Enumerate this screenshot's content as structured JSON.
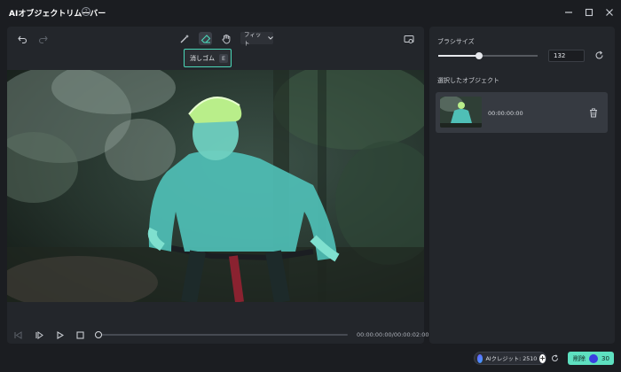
{
  "window": {
    "title": "AIオブジェクトリムーバー",
    "help_symbol": "?"
  },
  "toolbar": {
    "fit_label": "フィット",
    "tooltip_label": "消しゴム",
    "tooltip_key": "E"
  },
  "playback": {
    "time": "00:00:00:00/00:00:02:00"
  },
  "right_panel": {
    "brush_size_label": "ブラシサイズ",
    "brush_size_value": "132",
    "brush_size_fraction": 0.41,
    "selected_objects_label": "選択したオブジェクト",
    "objects": [
      {
        "time": "00:00:00:00"
      }
    ]
  },
  "footer": {
    "credit_text": "AIクレジット: 2510",
    "remove_label": "削除",
    "remove_cost": "30"
  },
  "colors": {
    "accent": "#5ee0c0",
    "tooltip_border": "#4ad7b8",
    "background": "#1b1d21",
    "panel": "#23262b"
  }
}
